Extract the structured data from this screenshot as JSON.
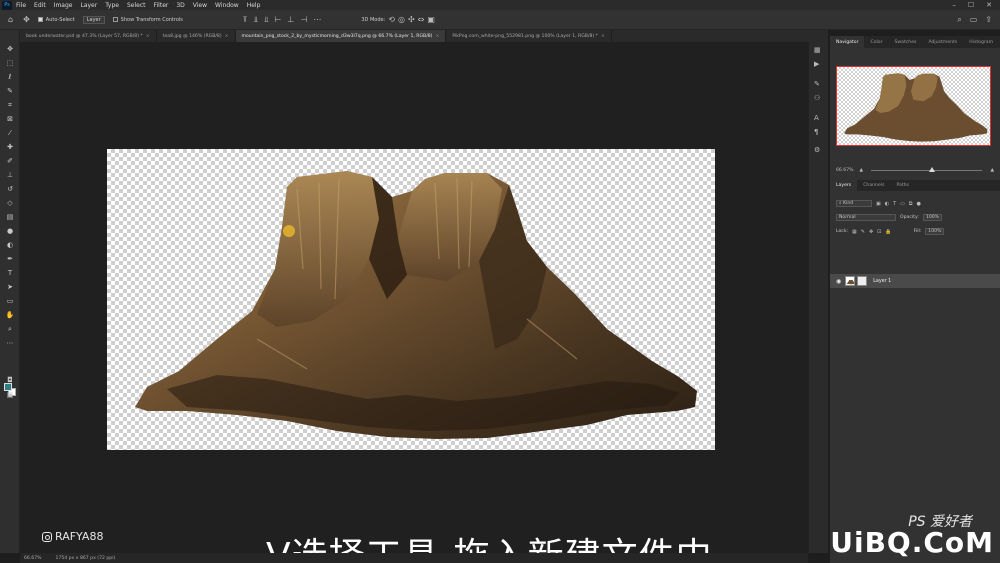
{
  "menubar": {
    "logo": "Ps",
    "items": [
      "File",
      "Edit",
      "Image",
      "Layer",
      "Type",
      "Select",
      "Filter",
      "3D",
      "View",
      "Window",
      "Help"
    ],
    "window_controls": [
      "–",
      "☐",
      "✕"
    ]
  },
  "options": {
    "auto_select_label": "Auto-Select",
    "auto_select_target": "Layer",
    "transform_controls_label": "Show Transform Controls",
    "mode_label": "3D Mode:"
  },
  "document_tabs": [
    {
      "label": "book underwater.psd @ 47.3% (Layer 57, RGB/8) *",
      "active": false
    },
    {
      "label": "tea8.jpg @ 146% (RGB/8)",
      "active": false
    },
    {
      "label": "mountain_png_stock_2_by_mysticmorning_d3w3l7q.png @ 66.7% (Layer 1, RGB/8)",
      "active": true
    },
    {
      "label": "PikPng.com_white-png_552981.png @ 100% (Layer 1, RGB/8) *",
      "active": false
    }
  ],
  "canvas": {
    "caption": "V选择工具-拖入新建文件中",
    "instagram_handle": "RAFYA88"
  },
  "statusbar": {
    "zoom": "66.67%",
    "doc_info": "1754 px x 867 px (72 ppi)"
  },
  "right_panel": {
    "top_tabs": [
      "Navigator",
      "Color",
      "Swatches",
      "Adjustments",
      "Histogram"
    ],
    "navigator_zoom": "66.67%",
    "navigator_zoom_fraction": 0.55,
    "layer_tabs": [
      "Layers",
      "Channels",
      "Paths"
    ],
    "kind_label": "Kind",
    "blend_mode": "Normal",
    "opacity_label": "Opacity:",
    "opacity_value": "100%",
    "lock_label": "Lock:",
    "fill_label": "Fill:",
    "fill_value": "100%",
    "layer_name": "Layer 1"
  },
  "watermark": {
    "top": "PS 爱好者",
    "main": "UiBQ.CoM"
  }
}
